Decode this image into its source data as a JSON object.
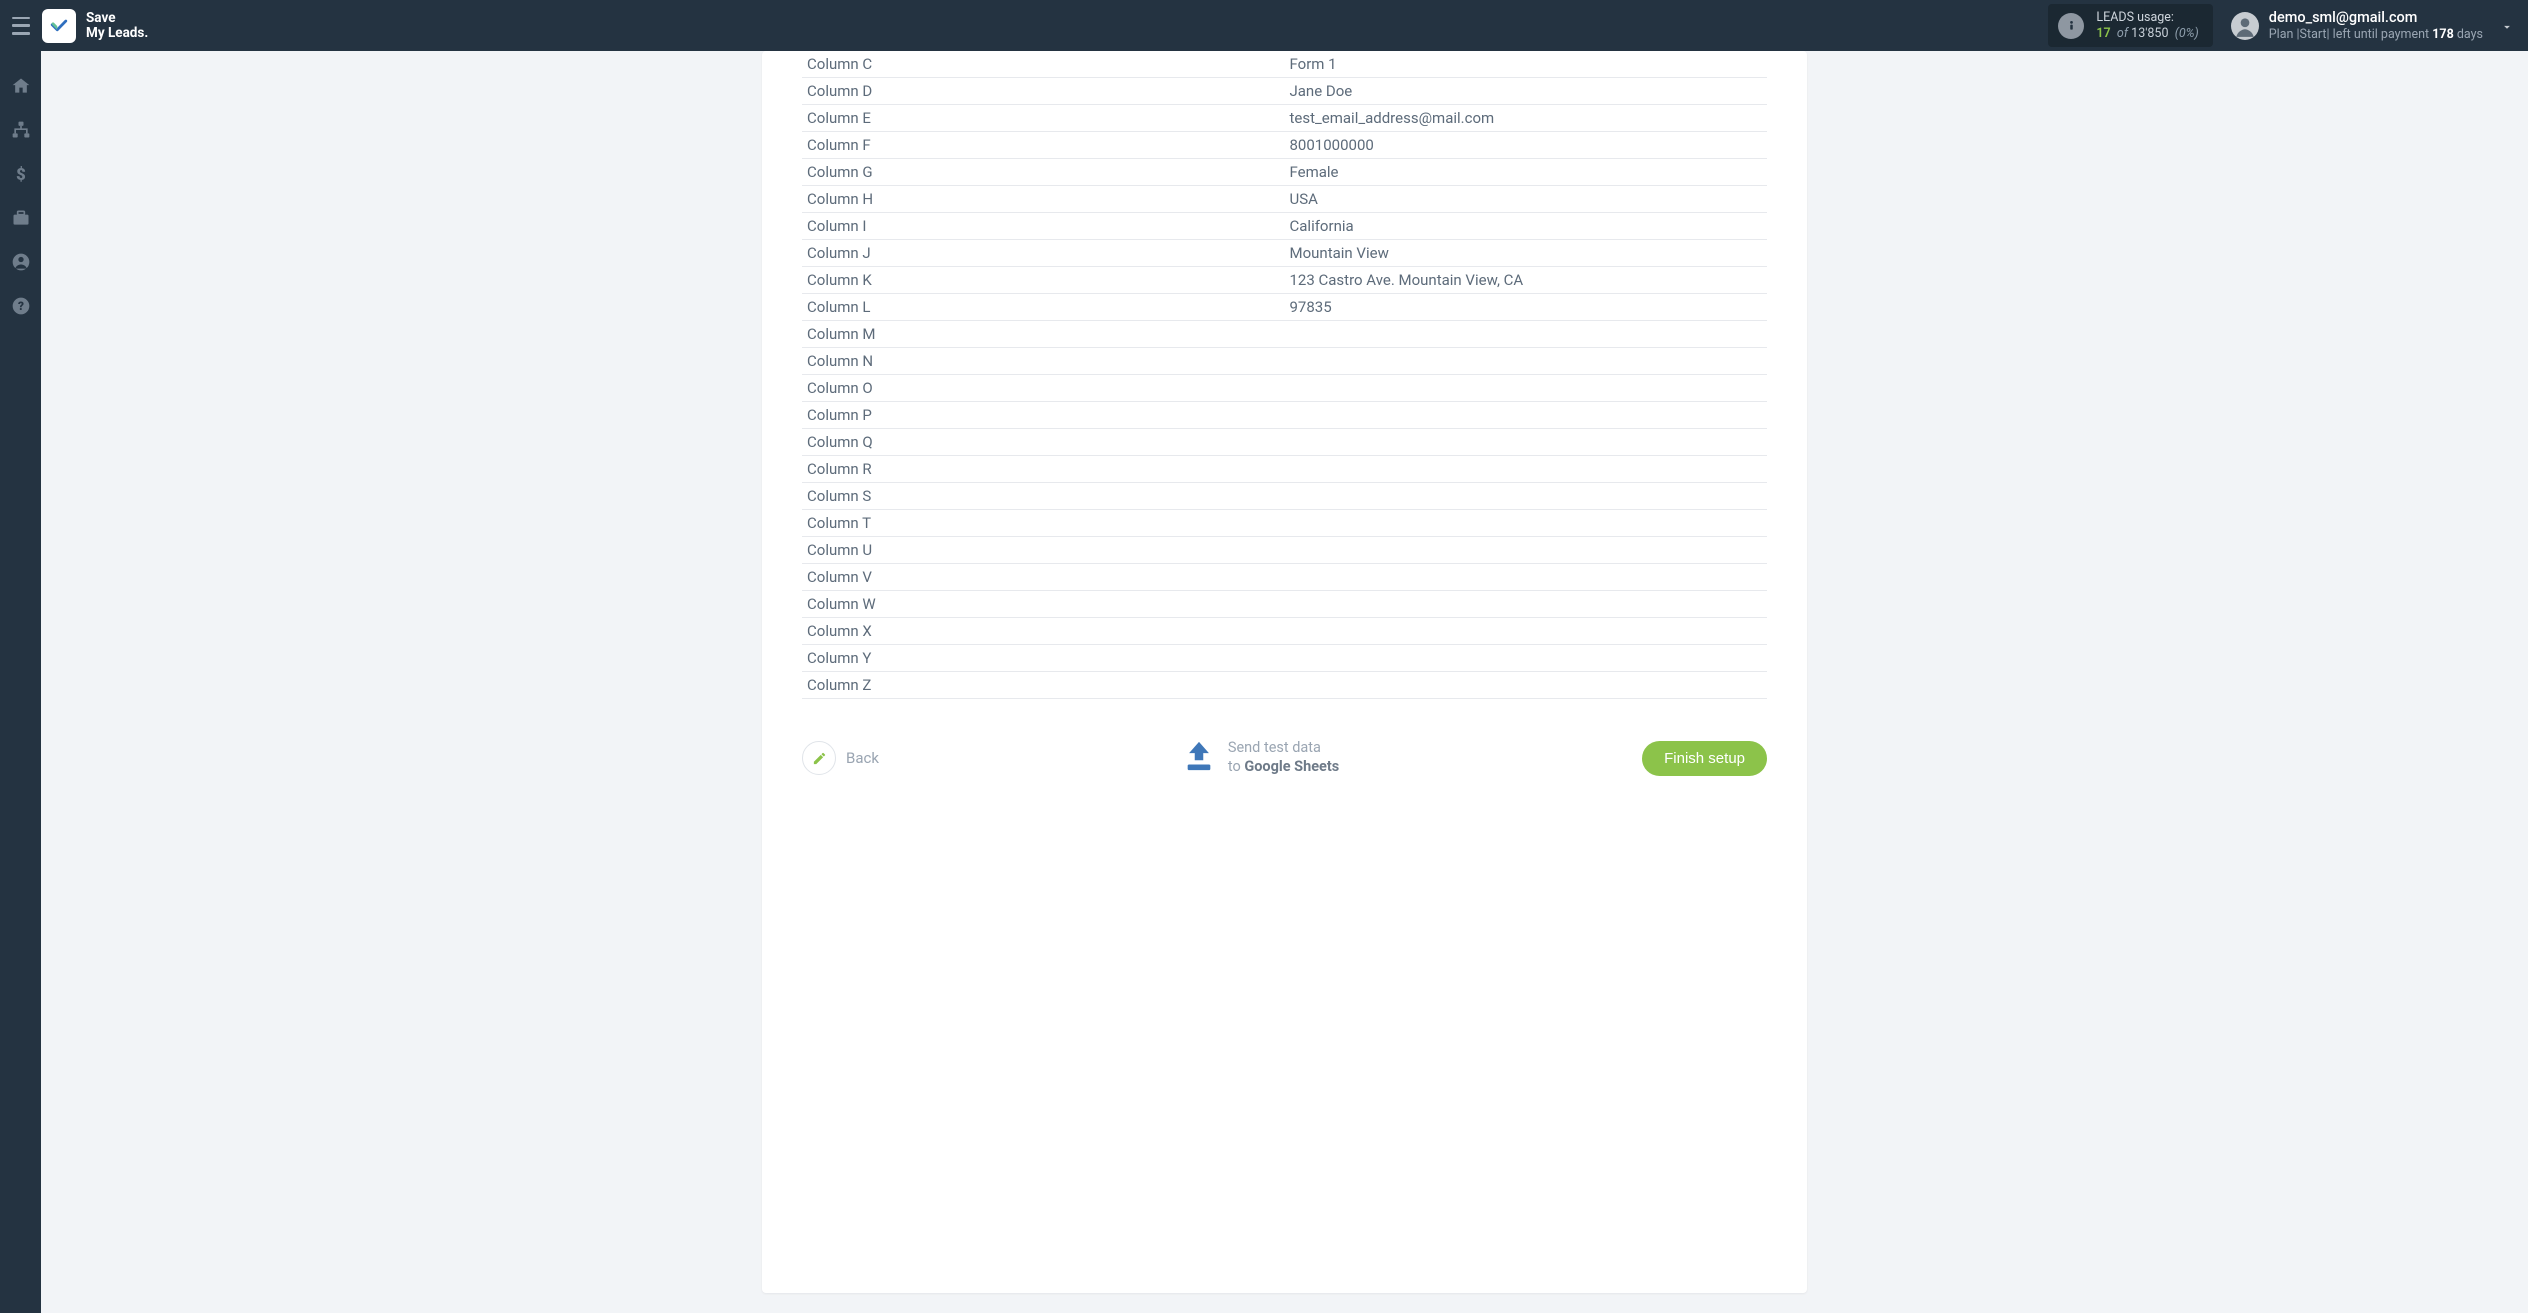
{
  "header": {
    "brand_line1": "Save",
    "brand_line2": "My Leads.",
    "usage": {
      "label": "LEADS usage:",
      "current": "17",
      "of_word": "of",
      "total": "13'850",
      "percent": "(0%)"
    },
    "user": {
      "email": "demo_sml@gmail.com",
      "plan_prefix": "Plan |Start| left until payment ",
      "plan_days_num": "178",
      "plan_days_word": " days"
    }
  },
  "table_rows": [
    {
      "key": "Column C",
      "val": "Form 1"
    },
    {
      "key": "Column D",
      "val": "Jane Doe"
    },
    {
      "key": "Column E",
      "val": "test_email_address@mail.com"
    },
    {
      "key": "Column F",
      "val": "8001000000"
    },
    {
      "key": "Column G",
      "val": "Female"
    },
    {
      "key": "Column H",
      "val": "USA"
    },
    {
      "key": "Column I",
      "val": "California"
    },
    {
      "key": "Column J",
      "val": "Mountain View"
    },
    {
      "key": "Column K",
      "val": "123 Castro Ave. Mountain View, CA"
    },
    {
      "key": "Column L",
      "val": "97835"
    },
    {
      "key": "Column M",
      "val": ""
    },
    {
      "key": "Column N",
      "val": ""
    },
    {
      "key": "Column O",
      "val": ""
    },
    {
      "key": "Column P",
      "val": ""
    },
    {
      "key": "Column Q",
      "val": ""
    },
    {
      "key": "Column R",
      "val": ""
    },
    {
      "key": "Column S",
      "val": ""
    },
    {
      "key": "Column T",
      "val": ""
    },
    {
      "key": "Column U",
      "val": ""
    },
    {
      "key": "Column V",
      "val": ""
    },
    {
      "key": "Column W",
      "val": ""
    },
    {
      "key": "Column X",
      "val": ""
    },
    {
      "key": "Column Y",
      "val": ""
    },
    {
      "key": "Column Z",
      "val": ""
    }
  ],
  "footer": {
    "back_label": "Back",
    "send_line1": "Send test data",
    "send_line2_prefix": "to ",
    "send_line2_bold": "Google Sheets",
    "finish_label": "Finish setup"
  }
}
